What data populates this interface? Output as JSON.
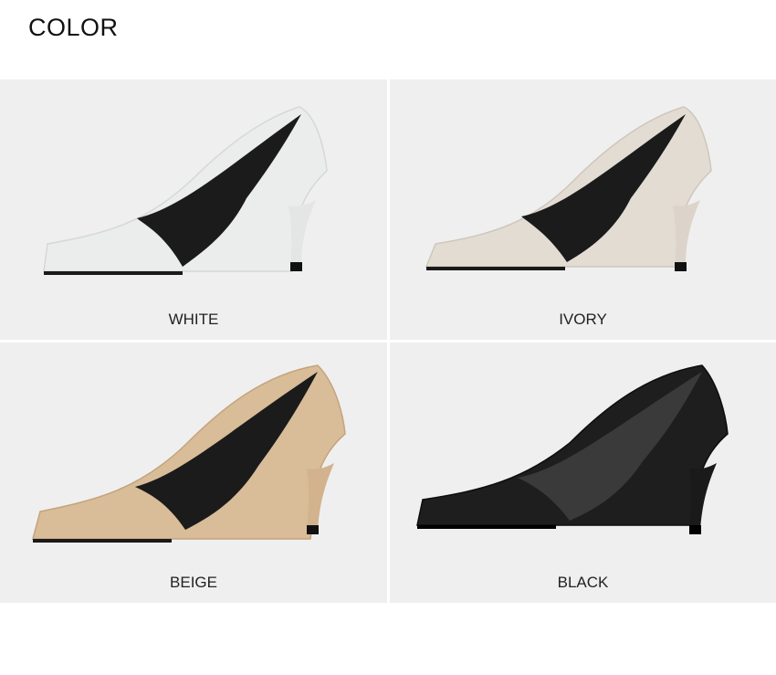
{
  "header": {
    "title": "COLOR"
  },
  "colors": [
    {
      "label": "WHITE",
      "upper": "#ebecec",
      "shade": "#d6d8d8",
      "lining": "#1b1b1b",
      "heel": "#e4e5e5"
    },
    {
      "label": "IVORY",
      "upper": "#e3dcd3",
      "shade": "#cfc6bb",
      "lining": "#1b1b1b",
      "heel": "#dcd4ca"
    },
    {
      "label": "BEIGE",
      "upper": "#d9bc98",
      "shade": "#c4a47e",
      "lining": "#1b1b1b",
      "heel": "#d2b38e"
    },
    {
      "label": "BLACK",
      "upper": "#1e1e1e",
      "shade": "#0d0d0d",
      "lining": "#3a3a3a",
      "heel": "#1a1a1a"
    }
  ]
}
